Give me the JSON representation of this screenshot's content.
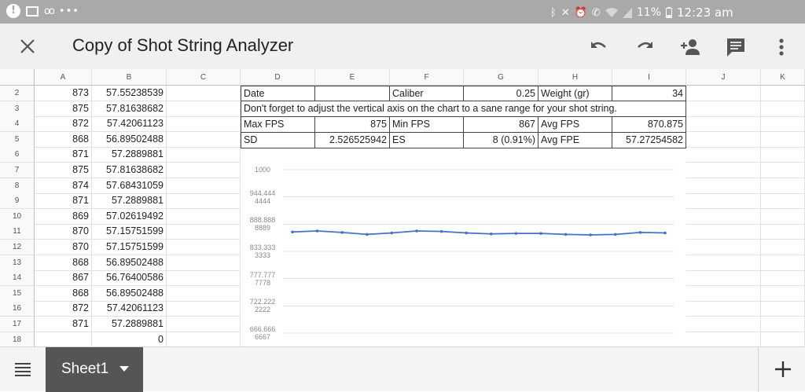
{
  "status_bar": {
    "time": "12:23 am",
    "battery": "11%",
    "left_icons": [
      "alert-icon",
      "mail-icon",
      "voicemail-icon",
      "more-dots-icon"
    ],
    "right_icons": [
      "bluetooth-icon",
      "mute-icon",
      "alarm-icon",
      "wifi-call-icon",
      "wifi-icon",
      "signal-icon",
      "battery-icon"
    ]
  },
  "app_bar": {
    "title": "Copy of Shot String Analyzer",
    "icons": [
      "close-icon",
      "undo-icon",
      "redo-icon",
      "add-person-icon",
      "comment-icon",
      "more-vert-icon"
    ]
  },
  "sheet": {
    "columns": [
      "A",
      "B",
      "C",
      "D",
      "E",
      "F",
      "G",
      "H",
      "I",
      "J",
      "K"
    ],
    "rows": [
      {
        "n": "2",
        "a": "873",
        "b": "57.55238539"
      },
      {
        "n": "3",
        "a": "875",
        "b": "57.81638682"
      },
      {
        "n": "4",
        "a": "872",
        "b": "57.42061123"
      },
      {
        "n": "5",
        "a": "868",
        "b": "56.89502488"
      },
      {
        "n": "6",
        "a": "871",
        "b": "57.2889881"
      },
      {
        "n": "7",
        "a": "875",
        "b": "57.81638682"
      },
      {
        "n": "8",
        "a": "874",
        "b": "57.68431059"
      },
      {
        "n": "9",
        "a": "871",
        "b": "57.2889881"
      },
      {
        "n": "10",
        "a": "869",
        "b": "57.02619492"
      },
      {
        "n": "11",
        "a": "870",
        "b": "57.15751599"
      },
      {
        "n": "12",
        "a": "870",
        "b": "57.15751599"
      },
      {
        "n": "13",
        "a": "868",
        "b": "56.89502488"
      },
      {
        "n": "14",
        "a": "867",
        "b": "56.76400586"
      },
      {
        "n": "15",
        "a": "868",
        "b": "56.89502488"
      },
      {
        "n": "16",
        "a": "872",
        "b": "57.42061123"
      },
      {
        "n": "17",
        "a": "871",
        "b": "57.2889881"
      },
      {
        "n": "18",
        "a": "",
        "b": "0"
      }
    ],
    "summary": {
      "date_label": "Date",
      "caliber_label": "Caliber",
      "caliber_value": "0.25",
      "weight_label": "Weight (gr)",
      "weight_value": "34",
      "note": "Don't forget to adjust the vertical axis on the chart to a sane range for your shot string.",
      "max_fps_label": "Max FPS",
      "max_fps_value": "875",
      "min_fps_label": "Min FPS",
      "min_fps_value": "867",
      "avg_fps_label": "Avg FPS",
      "avg_fps_value": "870.875",
      "sd_label": "SD",
      "sd_value": "2.526525942",
      "es_label": "ES",
      "es_value": "8 (0.91%)",
      "avg_fpe_label": "Avg FPE",
      "avg_fpe_value": "57.27254582"
    }
  },
  "chart_data": {
    "type": "line",
    "y_ticks": [
      [
        "1000"
      ],
      [
        "944.444",
        "4444"
      ],
      [
        "888.888",
        "8889"
      ],
      [
        "833.333",
        "3333"
      ],
      [
        "777.777",
        "7778"
      ],
      [
        "722.222",
        "2222"
      ],
      [
        "666.666",
        "6667"
      ]
    ],
    "ylim": [
      666.6666667,
      1000
    ],
    "series": [
      {
        "values": [
          873,
          875,
          872,
          868,
          871,
          875,
          874,
          871,
          869,
          870,
          870,
          868,
          867,
          868,
          872,
          871
        ],
        "color": "#4472c4"
      }
    ],
    "grid": true
  },
  "bottom_bar": {
    "sheet_tab": "Sheet1",
    "icons": [
      "sheets-menu-icon",
      "dropdown-arrow-icon",
      "add-sheet-icon"
    ]
  }
}
